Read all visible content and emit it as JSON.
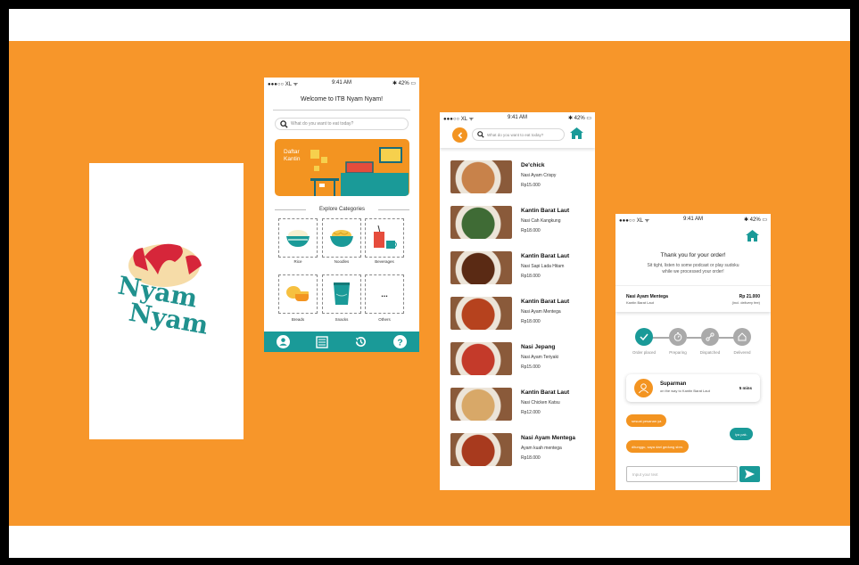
{
  "colors": {
    "orange": "#f39421",
    "teal": "#1a9a98",
    "background": "#f7962a"
  },
  "splash": {
    "logo_text_top": "Nyam",
    "logo_text_bottom": "Nyam"
  },
  "status_bar": {
    "carrier": "●●●○○ XL ᯤ",
    "time": "9:41 AM",
    "battery": "✱ 42% ▭"
  },
  "home": {
    "welcome": "Welcome to ITB Nyam Nyam!",
    "search_placeholder": "What do you want to eat today?",
    "banner_title": "Daftar Kantin",
    "explore_title": "Explore Categories",
    "categories": [
      {
        "label": "Rice",
        "icon": "rice-bowl-icon"
      },
      {
        "label": "Noodles",
        "icon": "noodle-bowl-icon"
      },
      {
        "label": "Beverages",
        "icon": "beverage-icon"
      },
      {
        "label": "Breads",
        "icon": "bread-icon"
      },
      {
        "label": "Snacks",
        "icon": "snack-bag-icon"
      },
      {
        "label": "Others",
        "icon": "more-icon",
        "glyph": "..."
      }
    ],
    "tabs": [
      "profile-icon",
      "menu-list-icon",
      "history-icon",
      "help-icon"
    ],
    "help_glyph": "?"
  },
  "list": {
    "search_placeholder": "What do you want to eat today?",
    "items": [
      {
        "title": "De'chick",
        "subtitle": "Nasi Ayam Crispy",
        "price": "Rp15.000",
        "color": "#c8824a"
      },
      {
        "title": "Kantin Barat Laut",
        "subtitle": "Nasi Cah Kangkung",
        "price": "Rp18.000",
        "color": "#3f6b35"
      },
      {
        "title": "Kantin Barat Laut",
        "subtitle": "Nasi Sapi Lada Hitam",
        "price": "Rp18.000",
        "color": "#5a2a14"
      },
      {
        "title": "Kantin Barat Laut",
        "subtitle": "Nasi Ayam Mentega",
        "price": "Rp18.000",
        "color": "#b6421e"
      },
      {
        "title": "Nasi Jepang",
        "subtitle": "Nasi Ayam Teriyaki",
        "price": "Rp15.000",
        "color": "#c43a2a"
      },
      {
        "title": "Kantin Barat Laut",
        "subtitle": "Nasi Chicken Katsu",
        "price": "Rp12.000",
        "color": "#d8a868"
      },
      {
        "title": "Nasi Ayam Mentega",
        "subtitle": "Ayam kuah mentega",
        "price": "Rp18.000",
        "color": "#a83a1e"
      }
    ]
  },
  "order": {
    "thanks": "Thank you for your order!",
    "sub_line1": "Sit tight, listen to some podcast or play sudoku",
    "sub_line2": "while we processed your order!",
    "item_name": "Nasi Ayam Mentega",
    "item_store": "Kantin Barat Laut",
    "price": "Rp 21.000",
    "price_note": "(incl. delivery fee)",
    "steps": [
      {
        "label": "Order placed",
        "icon": "check-icon",
        "active": true
      },
      {
        "label": "Preparing",
        "icon": "timer-icon",
        "active": false
      },
      {
        "label": "Dispatched",
        "icon": "delivery-icon",
        "active": false
      },
      {
        "label": "Delivered",
        "icon": "house-icon",
        "active": false
      }
    ],
    "driver_name": "Suparman",
    "driver_status": "on the way to Kantin Barat Laut",
    "eta": "5 mins",
    "chat": [
      {
        "text": "sesuai pesanan ya",
        "from": "user"
      },
      {
        "text": "iya pak.",
        "from": "driver"
      },
      {
        "text": "ditunggu, saya dari gedung sbm.",
        "from": "user"
      }
    ],
    "message_placeholder": "Input your text",
    "send_icon": "send-icon"
  }
}
